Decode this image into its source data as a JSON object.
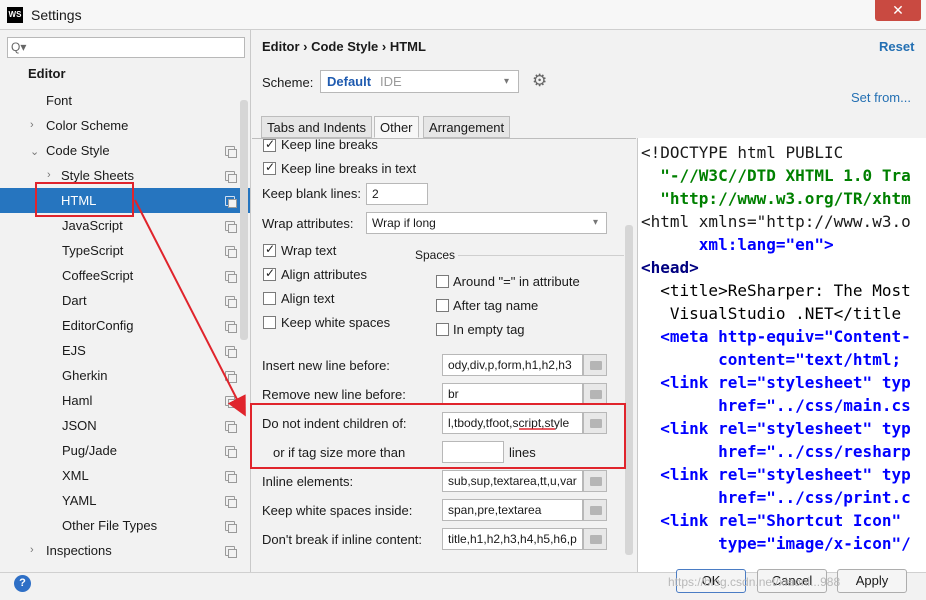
{
  "window": {
    "title": "Settings",
    "app_badge": "WS",
    "close_symbol": "✕"
  },
  "sidebar": {
    "search_placeholder": "Q▾",
    "items": [
      {
        "label": "Editor"
      },
      {
        "label": "Font"
      },
      {
        "label": "Color Scheme"
      },
      {
        "label": "Code Style"
      },
      {
        "label": "Style Sheets"
      },
      {
        "label": "HTML"
      },
      {
        "label": "JavaScript"
      },
      {
        "label": "TypeScript"
      },
      {
        "label": "CoffeeScript"
      },
      {
        "label": "Dart"
      },
      {
        "label": "EditorConfig"
      },
      {
        "label": "EJS"
      },
      {
        "label": "Gherkin"
      },
      {
        "label": "Haml"
      },
      {
        "label": "JSON"
      },
      {
        "label": "Pug/Jade"
      },
      {
        "label": "XML"
      },
      {
        "label": "YAML"
      },
      {
        "label": "Other File Types"
      },
      {
        "label": "Inspections"
      }
    ]
  },
  "header": {
    "breadcrumb": "Editor  ›  Code Style  ›  HTML",
    "reset_label": "Reset",
    "scheme_label": "Scheme:",
    "scheme_name": "Default",
    "scheme_type": "IDE",
    "set_from_label": "Set from..."
  },
  "tabs": [
    {
      "label": "Tabs and Indents"
    },
    {
      "label": "Other"
    },
    {
      "label": "Arrangement"
    }
  ],
  "form": {
    "keep_line_breaks": "Keep line breaks",
    "keep_line_breaks_text": "Keep line breaks in text",
    "keep_blank_lines_label": "Keep blank lines:",
    "keep_blank_lines_value": "2",
    "wrap_attributes_label": "Wrap attributes:",
    "wrap_attributes_value": "Wrap if long",
    "wrap_text": "Wrap text",
    "align_attributes": "Align attributes",
    "align_text": "Align text",
    "keep_white_spaces": "Keep white spaces",
    "spaces_header": "Spaces",
    "around_eq": "Around \"=\" in attribute",
    "after_tag_name": "After tag name",
    "in_empty_tag": "In empty tag",
    "insert_new_line_label": "Insert new line before:",
    "insert_new_line_value": "ody,div,p,form,h1,h2,h3",
    "remove_new_line_label": "Remove new line before:",
    "remove_new_line_value": "br",
    "no_indent_label": "Do not indent children of:",
    "no_indent_value": "l,tbody,tfoot,script,style",
    "tag_size_label": "or if tag size more than",
    "tag_size_value": "",
    "lines_label": "lines",
    "inline_elements_label": "Inline elements:",
    "inline_elements_value": "sub,sup,textarea,tt,u,var",
    "keep_ws_inside_label": "Keep white spaces inside:",
    "keep_ws_inside_value": "span,pre,textarea",
    "dont_break_label": "Don't break if inline content:",
    "dont_break_value": "title,h1,h2,h3,h4,h5,h6,p"
  },
  "preview": {
    "lines": [
      "<!DOCTYPE html PUBLIC",
      "  \"-//W3C//DTD XHTML 1.0 Tra",
      "  \"http://www.w3.org/TR/xhtm",
      "<html xmlns=\"http://www.w3.o",
      "      xml:lang=\"en\">",
      "<head>",
      "  <title>ReSharper: The Most",
      "   VisualStudio .NET</title",
      "  <meta http-equiv=\"Content-",
      "        content=\"text/html;",
      "  <link rel=\"stylesheet\" typ",
      "        href=\"../css/main.cs",
      "  <link rel=\"stylesheet\" typ",
      "        href=\"../css/resharp",
      "  <link rel=\"stylesheet\" typ",
      "        href=\"../css/print.c",
      "  <link rel=\"Shortcut Icon\"",
      "        type=\"image/x-icon\"/"
    ]
  },
  "footer": {
    "ok_label": "OK",
    "cancel_label": "Cancel",
    "apply_label": "Apply",
    "help_symbol": "?",
    "watermark": "https://blog.csdn.net/xiaoni...988"
  },
  "colors": {
    "selection": "#2675bf",
    "annotation_red": "#e0242c",
    "link_blue": "#2470b3"
  }
}
